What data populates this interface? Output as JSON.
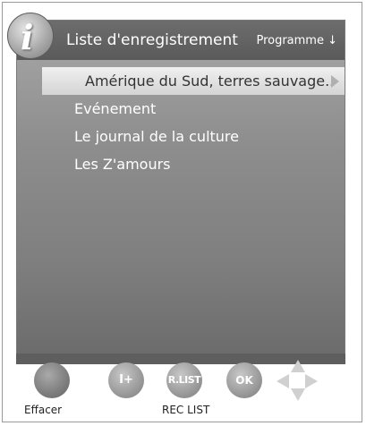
{
  "header": {
    "title": "Liste d'enregistrement",
    "sort_label": "Programme ↓"
  },
  "list": {
    "items": [
      {
        "label": "Amérique du Sud, terres sauvage..",
        "selected": true
      },
      {
        "label": "Evénement",
        "selected": false
      },
      {
        "label": "Le journal de la culture",
        "selected": false
      },
      {
        "label": "Les Z'amours",
        "selected": false
      }
    ]
  },
  "buttons": {
    "iplus": "I+",
    "rlist": "R.LIST",
    "ok": "OK"
  },
  "captions": {
    "red": "Effacer",
    "rlist": "REC LIST"
  },
  "icons": [
    "info-icon",
    "arrow-right-icon",
    "red-button-icon",
    "navigation-pad-icon"
  ]
}
